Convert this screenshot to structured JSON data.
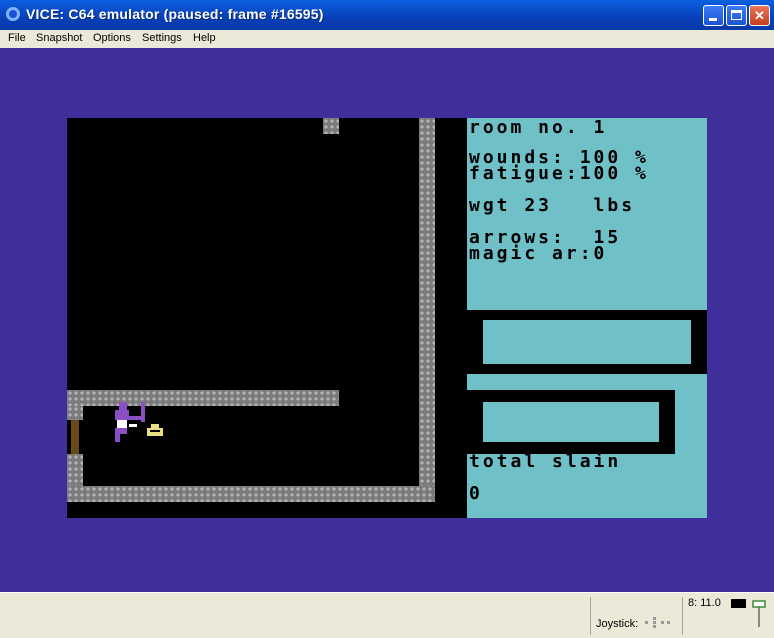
{
  "window": {
    "title": "VICE: C64 emulator (paused: frame #16595)",
    "colors": {
      "titlebar": "#0840b8",
      "emulator_border": "#3f2f9a",
      "panel": "#70c0c8",
      "wall": "#7b7b7b"
    }
  },
  "menubar": {
    "items": [
      "File",
      "Snapshot",
      "Options",
      "Settings",
      "Help"
    ]
  },
  "game": {
    "room_label": "room no. 1",
    "wounds_label": "wounds: 100 %",
    "fatigue_label": "fatigue:100 %",
    "weight_label": "wgt 23   lbs",
    "arrows_label": "arrows:  15",
    "magic_label": "magic ar:0",
    "total_slain_label": "total slain",
    "total_slain_value": "0"
  },
  "statusbar": {
    "joystick_label": "Joystick:",
    "drive_status": "8: 11.0"
  }
}
